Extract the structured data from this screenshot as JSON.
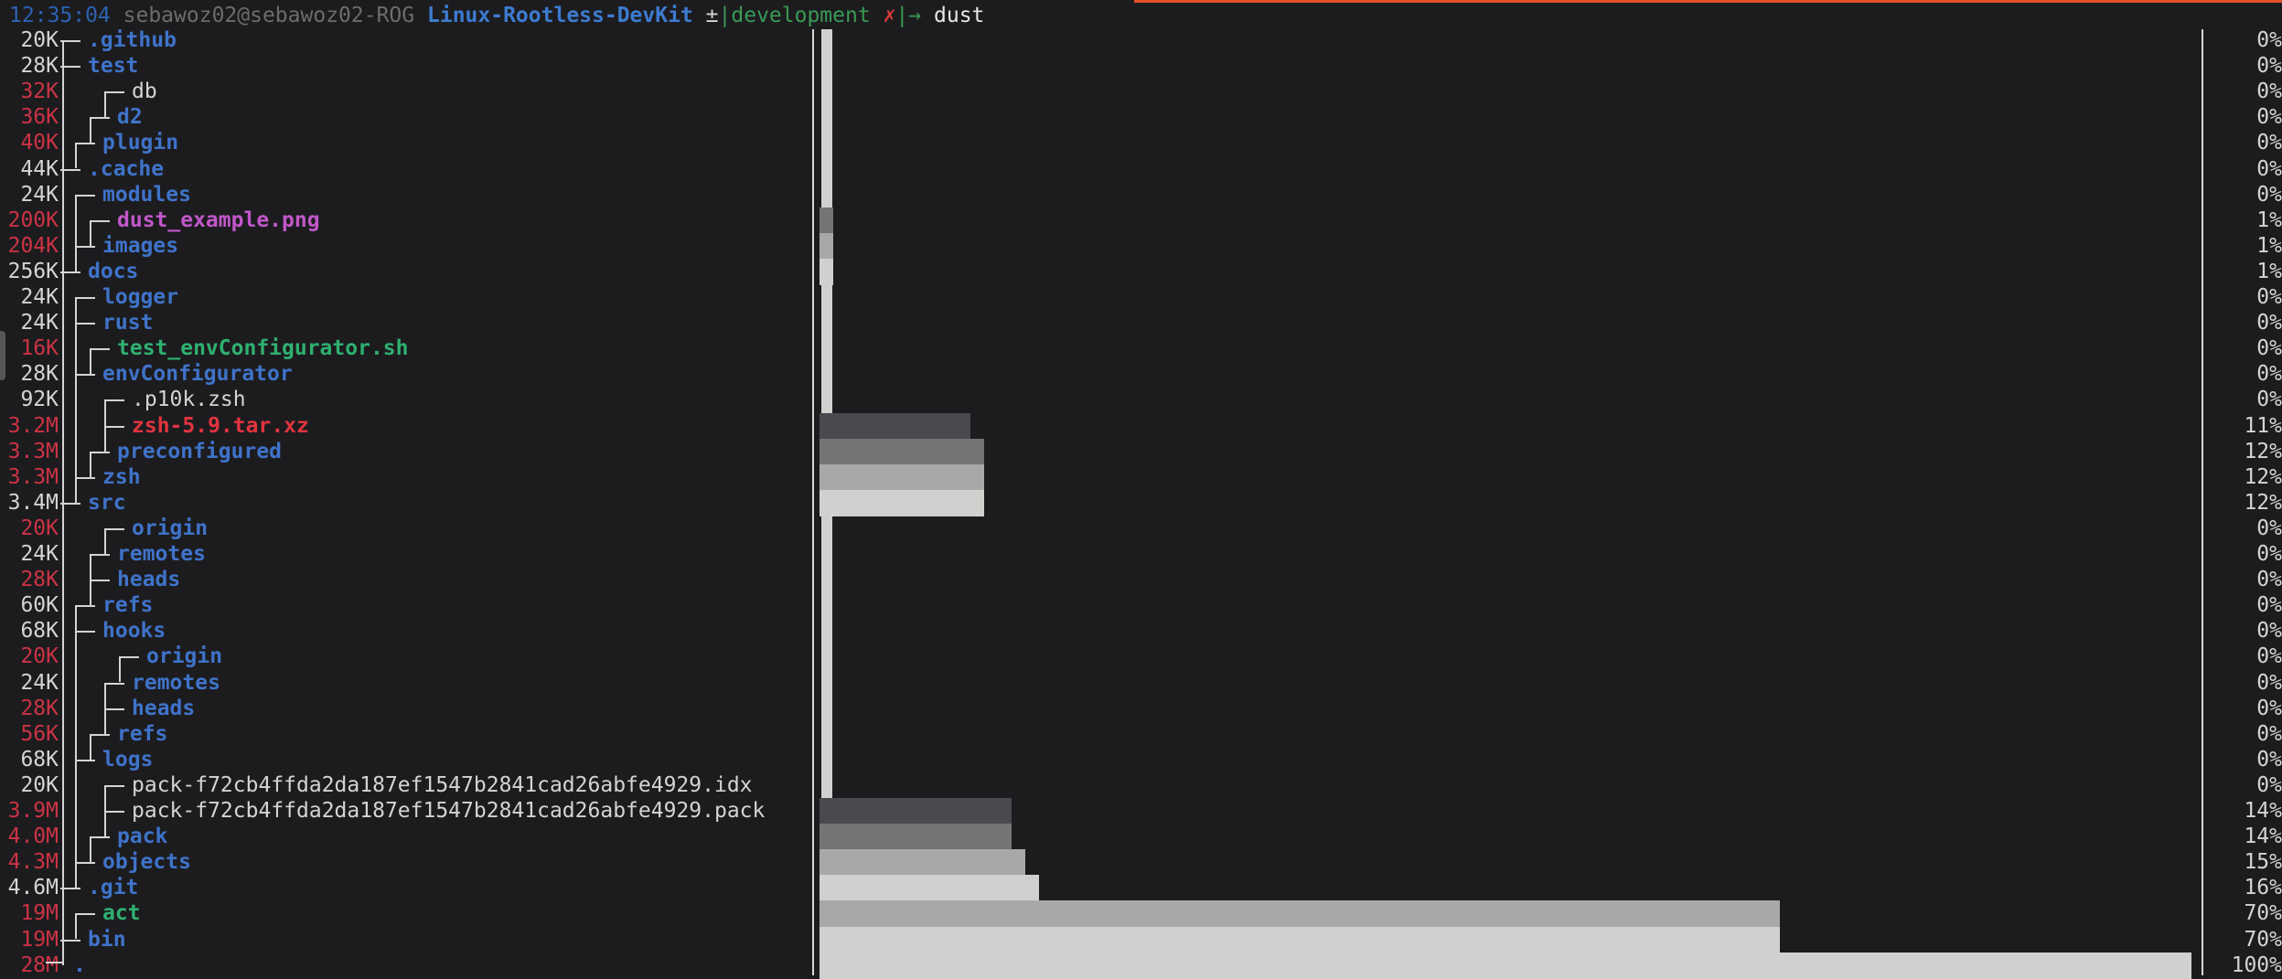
{
  "prompt": {
    "time": "12:35:04",
    "user": "sebawoz02@sebawoz02-ROG",
    "dir": "Linux-Rootless-DevKit",
    "vcs_symbol": "±",
    "pipe1": "|",
    "branch": "development",
    "dirty": "✗",
    "pipe2": "|",
    "arrow": "→",
    "command": "dust"
  },
  "rows": [
    {
      "size": "20K",
      "size_color": "normal",
      "name": ".github",
      "type": "dir",
      "depth": 1,
      "percent": "0%",
      "bar": 0
    },
    {
      "size": "28K",
      "size_color": "normal",
      "name": "test",
      "type": "dir",
      "depth": 1,
      "percent": "0%",
      "bar": 0
    },
    {
      "size": "32K",
      "size_color": "red",
      "name": "db",
      "type": "file",
      "depth": 4,
      "percent": "0%",
      "bar": 0
    },
    {
      "size": "36K",
      "size_color": "red",
      "name": "d2",
      "type": "dir",
      "depth": 3,
      "percent": "0%",
      "bar": 0
    },
    {
      "size": "40K",
      "size_color": "red",
      "name": "plugin",
      "type": "dir",
      "depth": 2,
      "percent": "0%",
      "bar": 0
    },
    {
      "size": "44K",
      "size_color": "normal",
      "name": ".cache",
      "type": "dir",
      "depth": 1,
      "percent": "0%",
      "bar": 0
    },
    {
      "size": "24K",
      "size_color": "normal",
      "name": "modules",
      "type": "dir",
      "depth": 2,
      "percent": "0%",
      "bar": 0
    },
    {
      "size": "200K",
      "size_color": "red",
      "name": "dust_example.png",
      "type": "image",
      "depth": 3,
      "percent": "1%",
      "bar": 1
    },
    {
      "size": "204K",
      "size_color": "red",
      "name": "images",
      "type": "dir",
      "depth": 2,
      "percent": "1%",
      "bar": 1
    },
    {
      "size": "256K",
      "size_color": "normal",
      "name": "docs",
      "type": "dir",
      "depth": 1,
      "percent": "1%",
      "bar": 1
    },
    {
      "size": "24K",
      "size_color": "normal",
      "name": "logger",
      "type": "dir",
      "depth": 2,
      "percent": "0%",
      "bar": 0
    },
    {
      "size": "24K",
      "size_color": "normal",
      "name": "rust",
      "type": "dir",
      "depth": 2,
      "percent": "0%",
      "bar": 0
    },
    {
      "size": "16K",
      "size_color": "red",
      "name": "test_envConfigurator.sh",
      "type": "exec",
      "depth": 3,
      "percent": "0%",
      "bar": 0
    },
    {
      "size": "28K",
      "size_color": "normal",
      "name": "envConfigurator",
      "type": "dir",
      "depth": 2,
      "percent": "0%",
      "bar": 0
    },
    {
      "size": "92K",
      "size_color": "normal",
      "name": ".p10k.zsh",
      "type": "file",
      "depth": 4,
      "percent": "0%",
      "bar": 0
    },
    {
      "size": "3.2M",
      "size_color": "red",
      "name": "zsh-5.9.tar.xz",
      "type": "archive",
      "depth": 4,
      "percent": "11%",
      "bar": 11
    },
    {
      "size": "3.3M",
      "size_color": "red",
      "name": "preconfigured",
      "type": "dir",
      "depth": 3,
      "percent": "12%",
      "bar": 12
    },
    {
      "size": "3.3M",
      "size_color": "red",
      "name": "zsh",
      "type": "dir",
      "depth": 2,
      "percent": "12%",
      "bar": 12
    },
    {
      "size": "3.4M",
      "size_color": "normal",
      "name": "src",
      "type": "dir",
      "depth": 1,
      "percent": "12%",
      "bar": 12
    },
    {
      "size": "20K",
      "size_color": "red",
      "name": "origin",
      "type": "dir",
      "depth": 4,
      "percent": "0%",
      "bar": 0
    },
    {
      "size": "24K",
      "size_color": "normal",
      "name": "remotes",
      "type": "dir",
      "depth": 3,
      "percent": "0%",
      "bar": 0
    },
    {
      "size": "28K",
      "size_color": "red",
      "name": "heads",
      "type": "dir",
      "depth": 3,
      "percent": "0%",
      "bar": 0
    },
    {
      "size": "60K",
      "size_color": "normal",
      "name": "refs",
      "type": "dir",
      "depth": 2,
      "percent": "0%",
      "bar": 0
    },
    {
      "size": "68K",
      "size_color": "normal",
      "name": "hooks",
      "type": "dir",
      "depth": 2,
      "percent": "0%",
      "bar": 0
    },
    {
      "size": "20K",
      "size_color": "red",
      "name": "origin",
      "type": "dir",
      "depth": 5,
      "percent": "0%",
      "bar": 0
    },
    {
      "size": "24K",
      "size_color": "normal",
      "name": "remotes",
      "type": "dir",
      "depth": 4,
      "percent": "0%",
      "bar": 0
    },
    {
      "size": "28K",
      "size_color": "red",
      "name": "heads",
      "type": "dir",
      "depth": 4,
      "percent": "0%",
      "bar": 0
    },
    {
      "size": "56K",
      "size_color": "red",
      "name": "refs",
      "type": "dir",
      "depth": 3,
      "percent": "0%",
      "bar": 0
    },
    {
      "size": "68K",
      "size_color": "normal",
      "name": "logs",
      "type": "dir",
      "depth": 2,
      "percent": "0%",
      "bar": 0
    },
    {
      "size": "20K",
      "size_color": "normal",
      "name": "pack-f72cb4ffda2da187ef1547b2841cad26abfe4929.idx",
      "type": "file",
      "depth": 4,
      "percent": "0%",
      "bar": 0
    },
    {
      "size": "3.9M",
      "size_color": "red",
      "name": "pack-f72cb4ffda2da187ef1547b2841cad26abfe4929.pack",
      "type": "file",
      "depth": 4,
      "percent": "14%",
      "bar": 14
    },
    {
      "size": "4.0M",
      "size_color": "red",
      "name": "pack",
      "type": "dir",
      "depth": 3,
      "percent": "14%",
      "bar": 14
    },
    {
      "size": "4.3M",
      "size_color": "red",
      "name": "objects",
      "type": "dir",
      "depth": 2,
      "percent": "15%",
      "bar": 15
    },
    {
      "size": "4.6M",
      "size_color": "normal",
      "name": ".git",
      "type": "dir",
      "depth": 1,
      "percent": "16%",
      "bar": 16
    },
    {
      "size": "19M",
      "size_color": "red",
      "name": "act",
      "type": "exec",
      "depth": 2,
      "percent": "70%",
      "bar": 70
    },
    {
      "size": "19M",
      "size_color": "red",
      "name": "bin",
      "type": "dir",
      "depth": 1,
      "percent": "70%",
      "bar": 70
    },
    {
      "size": "28M",
      "size_color": "red",
      "name": ".",
      "type": "dir",
      "depth": 0,
      "percent": "100%",
      "bar": 100
    }
  ]
}
